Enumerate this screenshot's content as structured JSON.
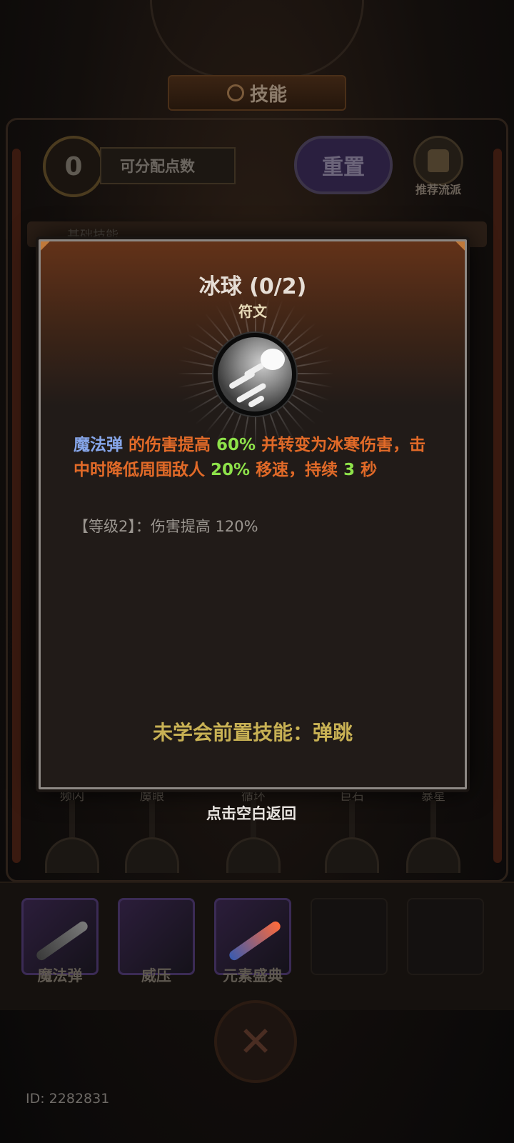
{
  "header": {
    "title": "技能"
  },
  "points": {
    "value": "0",
    "label": "可分配点数"
  },
  "reset_button": {
    "label": "重置"
  },
  "recommend_button": {
    "label": "推荐流派"
  },
  "section": {
    "label": "基础技能"
  },
  "skill_rows": [
    {
      "label": "频闪"
    },
    {
      "label": "魔眼"
    },
    {
      "label": "循环"
    },
    {
      "label": "巨石"
    },
    {
      "label": "暴星"
    }
  ],
  "equipped_skills": [
    {
      "label": "魔法弹"
    },
    {
      "label": "威压"
    },
    {
      "label": "元素盛典"
    }
  ],
  "player_id": "ID: 2282831",
  "modal": {
    "title": "冰球 (0/2)",
    "subtitle": "符文",
    "description": {
      "skill": "魔法弹",
      "p1": " 的伤害提高 ",
      "v1": "60%",
      "p2": " 并转变为冰寒伤害，击中时降低周围敌人 ",
      "v2": "20%",
      "p3": " 移速，持续 ",
      "v3": "3",
      "p4": " 秒"
    },
    "level_info": "【等级2】：伤害提高 120%",
    "prerequisite": "未学会前置技能：弹跳",
    "dismiss_hint": "点击空白返回"
  },
  "colors": {
    "skill_name": "#86a6ea",
    "highlight_value": "#8ee24a",
    "description_text": "#e16a28",
    "prerequisite_text": "#c8b154"
  }
}
